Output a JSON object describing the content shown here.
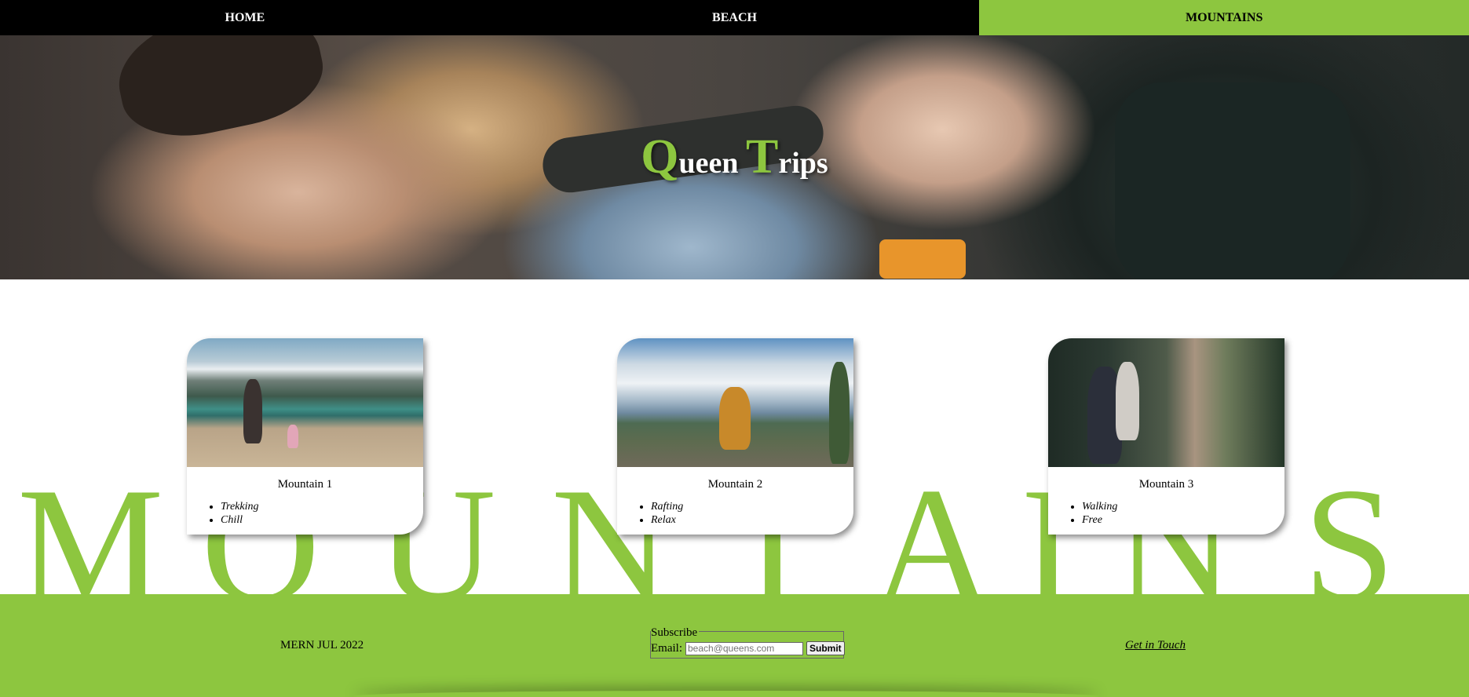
{
  "nav": {
    "items": [
      {
        "label": "HOME"
      },
      {
        "label": "BEACH"
      },
      {
        "label": "MOUNTAINS"
      }
    ],
    "active": "MOUNTAINS"
  },
  "hero": {
    "title_q": "Q",
    "title_ueen": "ueen ",
    "title_t": "T",
    "title_rips": "rips"
  },
  "background_word": [
    "M",
    "O",
    "U",
    "N",
    "T",
    "A",
    "I",
    "N",
    "S"
  ],
  "cards": [
    {
      "title": "Mountain 1",
      "features": [
        "Trekking",
        "Chill"
      ]
    },
    {
      "title": "Mountain 2",
      "features": [
        "Rafting",
        "Relax"
      ]
    },
    {
      "title": "Mountain 3",
      "features": [
        "Walking",
        "Free"
      ]
    }
  ],
  "footer": {
    "left_text": "MERN JUL 2022",
    "subscribe": {
      "legend": "Subscribe",
      "email_label": "Email:",
      "email_placeholder": "beach@queens.com",
      "submit_label": "Submit"
    },
    "contact_link": "Get in Touch"
  },
  "colors": {
    "accent": "#8dc63f",
    "nav_bg": "#000000"
  }
}
